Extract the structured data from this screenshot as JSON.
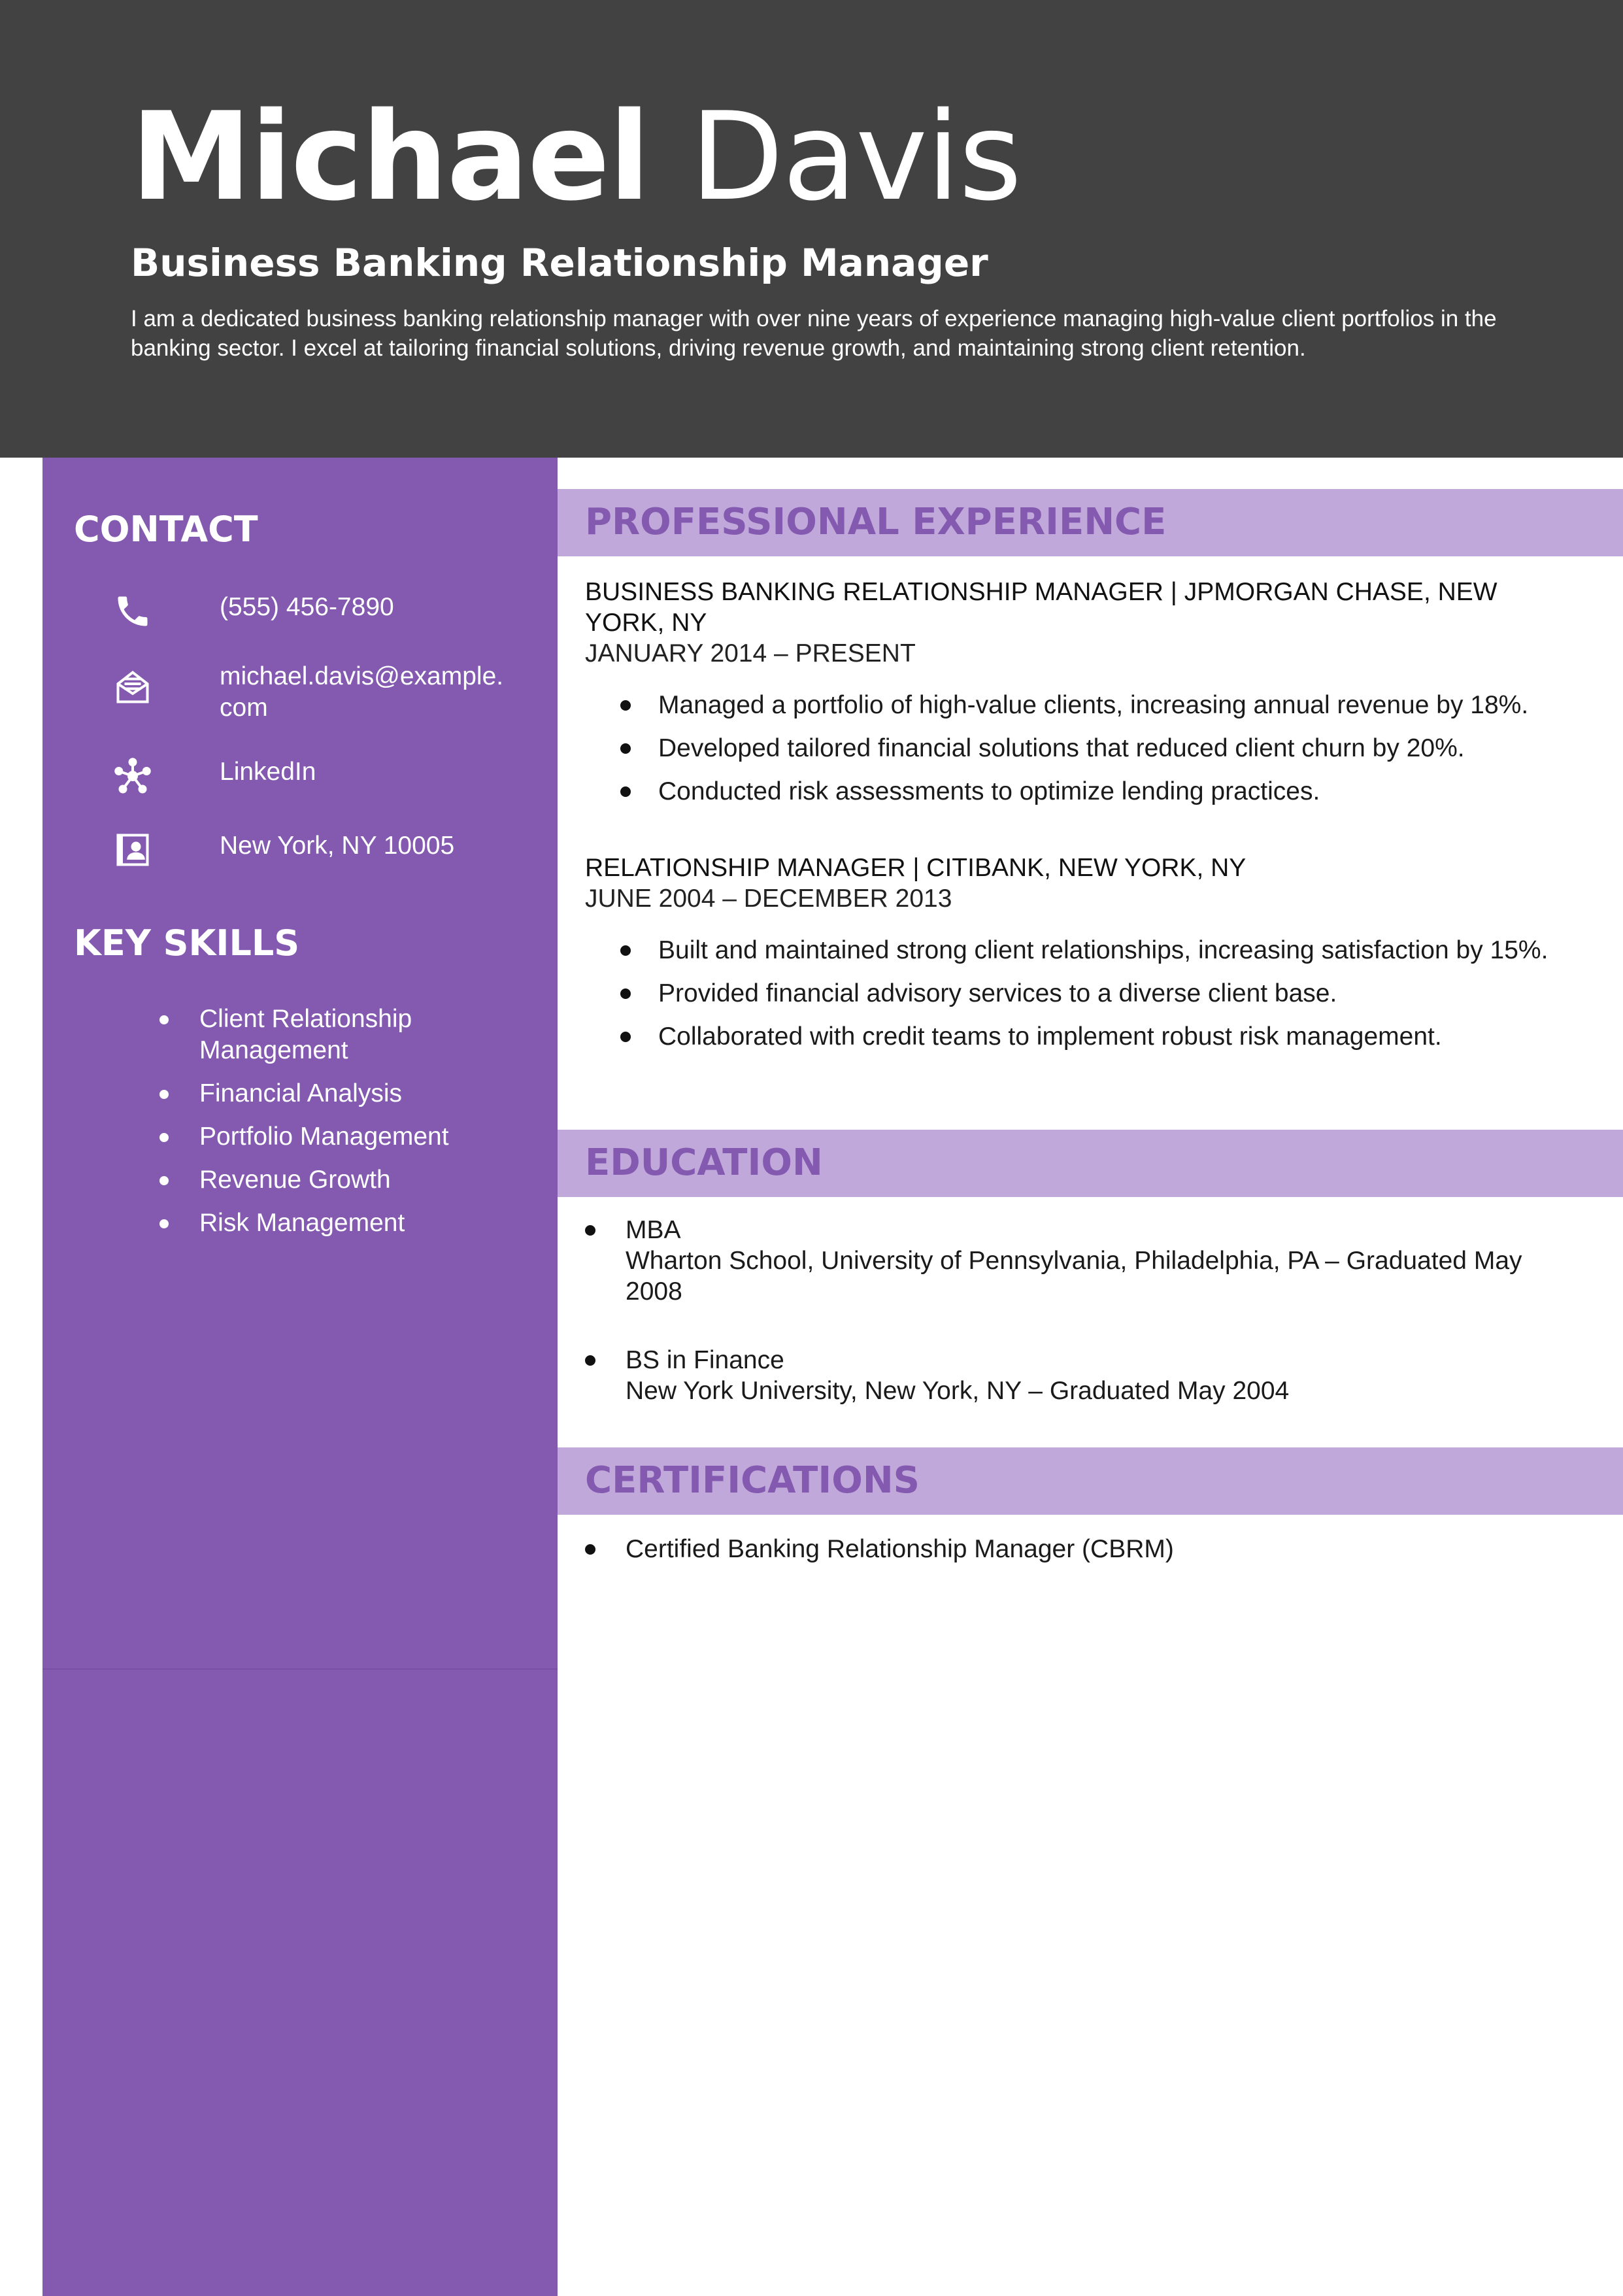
{
  "header": {
    "first_name": "Michael",
    "last_name": "Davis",
    "title": "Business Banking Relationship Manager",
    "summary": "I am a dedicated business banking relationship manager with over nine years of experience managing high-value client portfolios in the banking sector. I excel at tailoring financial solutions, driving revenue growth, and maintaining strong client retention."
  },
  "sidebar": {
    "contact_heading": "CONTACT",
    "contact": [
      {
        "icon": "phone-icon",
        "text": "(555) 456-7890"
      },
      {
        "icon": "email-icon",
        "text": "michael.davis@example.com"
      },
      {
        "icon": "network-icon",
        "text": "LinkedIn"
      },
      {
        "icon": "address-card-icon",
        "text": "New York, NY 10005"
      }
    ],
    "skills_heading": "KEY SKILLS",
    "skills": [
      "Client Relationship Management",
      "Financial Analysis",
      "Portfolio Management",
      "Revenue Growth",
      "Risk Management"
    ]
  },
  "experience": {
    "heading": "PROFESSIONAL EXPERIENCE",
    "jobs": [
      {
        "title": "BUSINESS BANKING RELATIONSHIP MANAGER | JPMORGAN CHASE, NEW YORK, NY",
        "dates": "JANUARY 2014 – PRESENT",
        "bullets": [
          "Managed a portfolio of high-value clients, increasing annual revenue by 18%.",
          "Developed tailored financial solutions that reduced client churn by 20%.",
          "Conducted risk assessments to optimize lending practices."
        ]
      },
      {
        "title": "RELATIONSHIP MANAGER | CITIBANK, NEW YORK, NY",
        "dates": "JUNE 2004 – DECEMBER 2013",
        "bullets": [
          "Built and maintained strong client relationships, increasing satisfaction by 15%.",
          "Provided financial advisory services to a diverse client base.",
          "Collaborated with credit teams to implement robust risk management."
        ]
      }
    ]
  },
  "education": {
    "heading": "EDUCATION",
    "items": [
      {
        "degree": "MBA",
        "detail": "Wharton School, University of Pennsylvania, Philadelphia, PA – Graduated May 2008"
      },
      {
        "degree": "BS in Finance",
        "detail": "New York University, New York, NY – Graduated May 2004"
      }
    ]
  },
  "certifications": {
    "heading": "CERTIFICATIONS",
    "items": [
      "Certified Banking Relationship Manager (CBRM)"
    ]
  },
  "colors": {
    "header_bg": "#424242",
    "sidebar_bg": "#8459b0",
    "section_bar_bg": "#c0a8da",
    "section_heading": "#8459b0"
  }
}
